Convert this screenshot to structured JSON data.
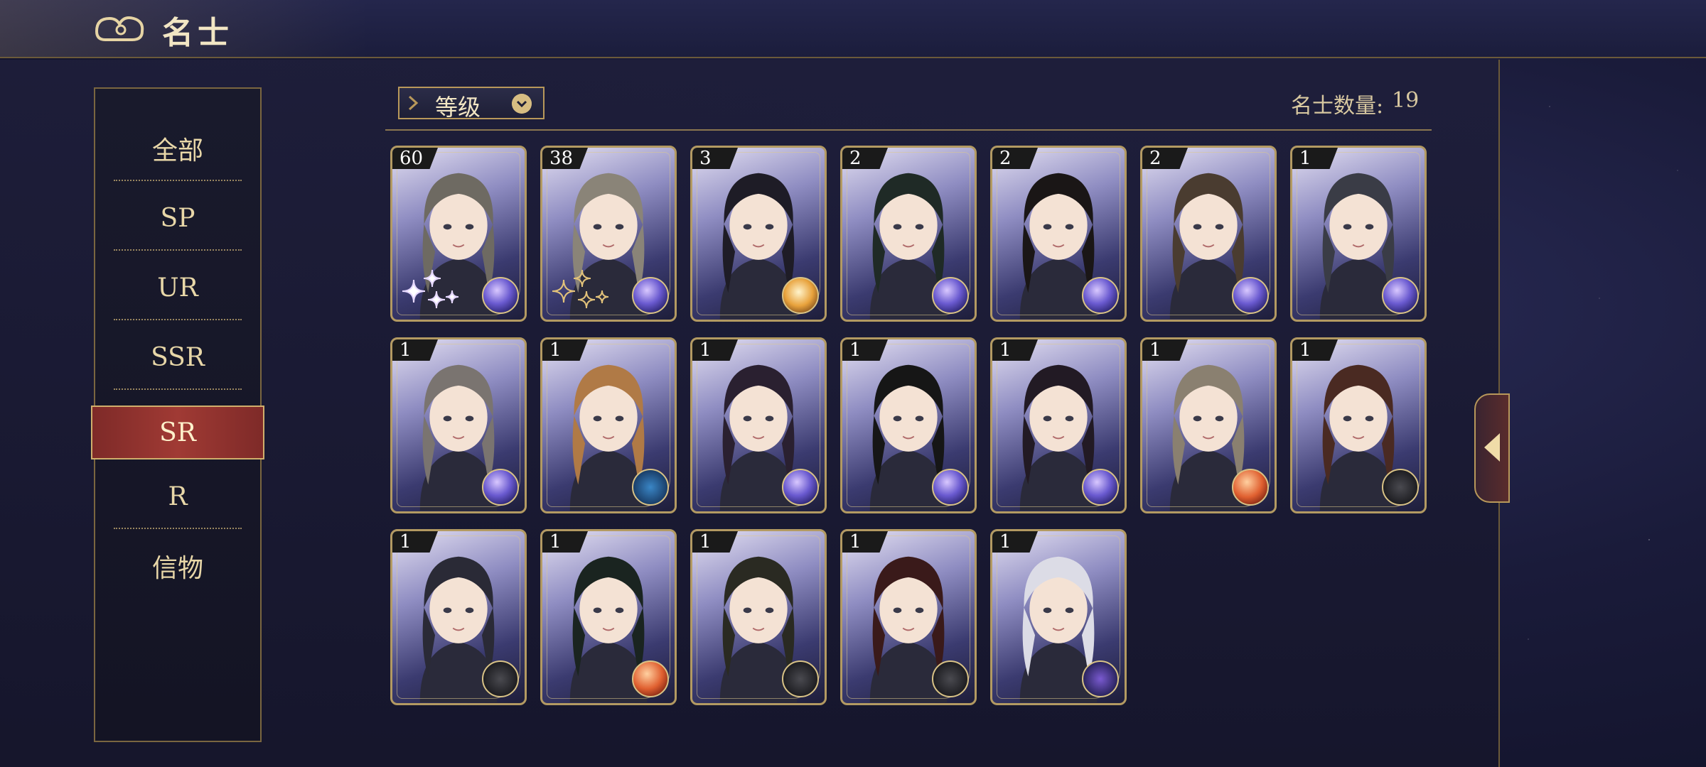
{
  "header": {
    "title": "名士"
  },
  "sidebar": {
    "items": [
      {
        "label": "全部"
      },
      {
        "label": "SP"
      },
      {
        "label": "UR"
      },
      {
        "label": "SSR"
      },
      {
        "label": "SR",
        "active": true
      },
      {
        "label": "R"
      },
      {
        "label": "信物"
      }
    ]
  },
  "toolbar": {
    "sort_label": "等级",
    "count_label": "名士数量:",
    "count_value": "19"
  },
  "cards": [
    {
      "level": "60",
      "element": "cosmos",
      "sparkles": "white"
    },
    {
      "level": "38",
      "element": "cosmos",
      "sparkles": "gold"
    },
    {
      "level": "3",
      "element": "sun"
    },
    {
      "level": "2",
      "element": "cosmos"
    },
    {
      "level": "2",
      "element": "cosmos"
    },
    {
      "level": "2",
      "element": "cosmos"
    },
    {
      "level": "1",
      "element": "cosmos"
    },
    {
      "level": "1",
      "element": "cosmos"
    },
    {
      "level": "1",
      "element": "eye"
    },
    {
      "level": "1",
      "element": "cosmos"
    },
    {
      "level": "1",
      "element": "cosmos"
    },
    {
      "level": "1",
      "element": "cosmos"
    },
    {
      "level": "1",
      "element": "planet"
    },
    {
      "level": "1",
      "element": "compass"
    },
    {
      "level": "1",
      "element": "compass"
    },
    {
      "level": "1",
      "element": "planet"
    },
    {
      "level": "1",
      "element": "compass"
    },
    {
      "level": "1",
      "element": "compass"
    },
    {
      "level": "1",
      "element": "moon"
    }
  ],
  "colors": {
    "accent_gold": "#b8985a",
    "active_tab": "#a03a34",
    "background": "#1a1b3a"
  }
}
